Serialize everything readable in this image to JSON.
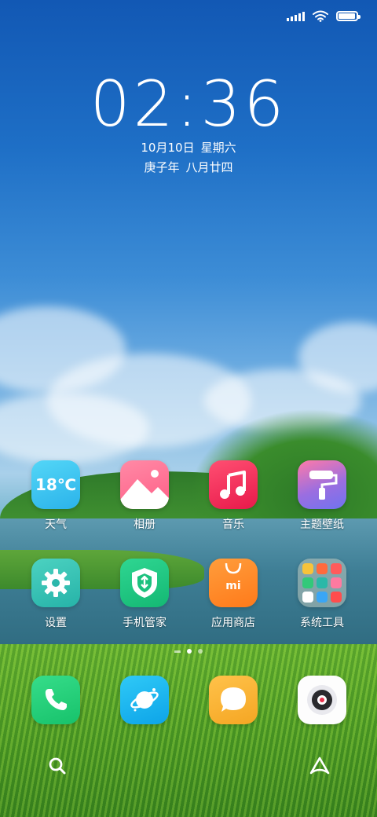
{
  "status_bar": {
    "signal_icon": "cellular-signal-icon",
    "wifi_icon": "wifi-icon",
    "battery_icon": "battery-icon",
    "battery_level": 0.95
  },
  "lockscreen": {
    "time": "02:36",
    "date": "10月10日",
    "weekday": "星期六",
    "lunar_year": "庚子年",
    "lunar_date": "八月廿四"
  },
  "apps": [
    {
      "label": "天气",
      "icon": "weather-icon",
      "text": "18℃",
      "color": "#3fc6ef"
    },
    {
      "label": "相册",
      "icon": "gallery-icon",
      "color": "#ff6d8f"
    },
    {
      "label": "音乐",
      "icon": "music-icon",
      "color": "#f5365c"
    },
    {
      "label": "主题壁纸",
      "icon": "themes-icon",
      "color": "#a36cd8"
    },
    {
      "label": "设置",
      "icon": "settings-icon",
      "color": "#36c4b5"
    },
    {
      "label": "手机管家",
      "icon": "security-icon",
      "color": "#1fc682"
    },
    {
      "label": "应用商店",
      "icon": "app-store-icon",
      "text": "mi",
      "color": "#ff8a27"
    },
    {
      "label": "系统工具",
      "icon": "folder-icon",
      "color": "#9aa39a"
    }
  ],
  "dock": [
    {
      "icon": "phone-icon",
      "color": "#25d07b"
    },
    {
      "icon": "browser-icon",
      "color": "#1ab5f0"
    },
    {
      "icon": "messages-icon",
      "color": "#f7b733"
    },
    {
      "icon": "camera-icon",
      "color": "#ffffff"
    }
  ],
  "page_indicator": {
    "pages": 2,
    "current": 0
  },
  "bottom_bar": {
    "search_icon": "search-icon",
    "assistant_icon": "assistant-icon"
  }
}
